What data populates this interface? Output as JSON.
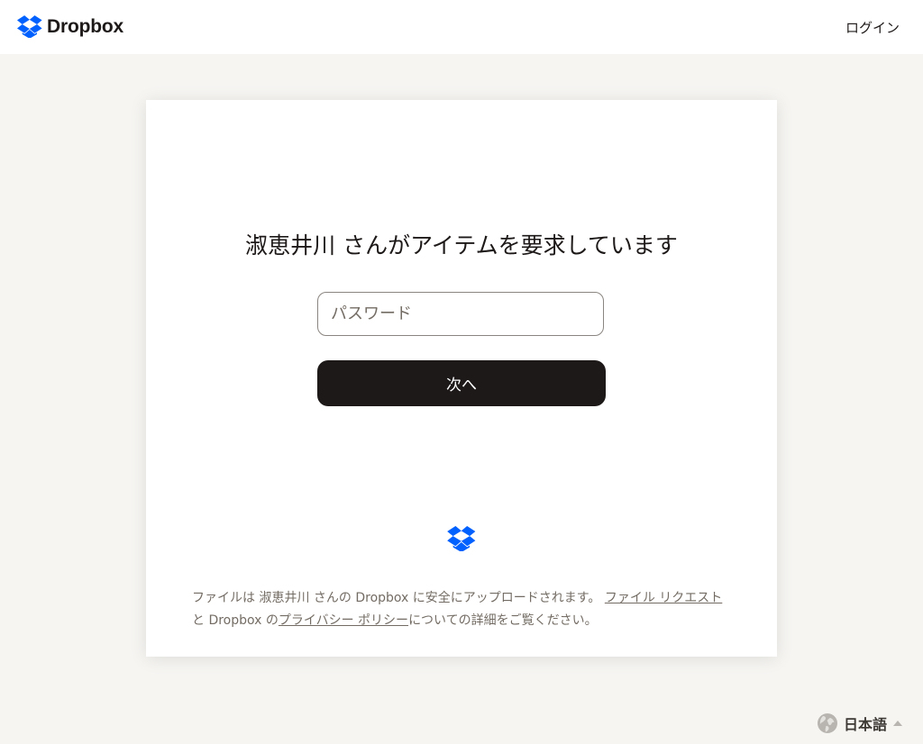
{
  "header": {
    "brand": "Dropbox",
    "login_label": "ログイン"
  },
  "card": {
    "heading": "淑恵井川 さんがアイテムを要求しています",
    "password_placeholder": "パスワード",
    "next_label": "次へ",
    "footer": {
      "text_before": "ファイルは 淑恵井川 さんの Dropbox に安全にアップロードされます。",
      "link_file_request": "ファイル リクエスト",
      "text_middle": "と Dropbox の",
      "link_privacy": "プライバシー ポリシー",
      "text_after": "についての詳細をご覧ください。"
    }
  },
  "language": {
    "label": "日本語"
  },
  "colors": {
    "brand_blue": "#0061fe",
    "button_dark": "#1e1919",
    "page_background": "#f6f5f2"
  },
  "icons": {
    "logo": "dropbox-logo-icon",
    "language": "globe-icon",
    "language_caret": "caret-up-icon"
  }
}
